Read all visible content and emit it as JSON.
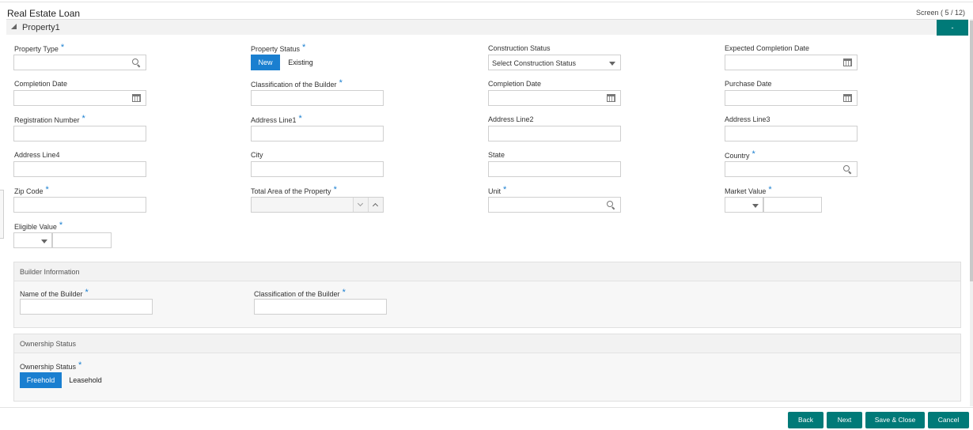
{
  "header": {
    "title": "Real Estate Loan",
    "screen_counter": "Screen ( 5 / 12)"
  },
  "section": {
    "title": "Property1",
    "collapse_label": "-"
  },
  "fields": {
    "property_type": {
      "label": "Property Type",
      "required": "*"
    },
    "property_status": {
      "label": "Property Status",
      "required": "*",
      "options": [
        "New",
        "Existing"
      ],
      "selected": "New"
    },
    "construction_status": {
      "label": "Construction Status",
      "value": "Select Construction Status"
    },
    "expected_completion_date": {
      "label": "Expected Completion Date"
    },
    "completion_date_1": {
      "label": "Completion Date"
    },
    "classification_builder": {
      "label": "Classification of the Builder",
      "required": "*"
    },
    "completion_date_2": {
      "label": "Completion Date"
    },
    "purchase_date": {
      "label": "Purchase Date"
    },
    "registration_number": {
      "label": "Registration Number",
      "required": "*"
    },
    "address_line1": {
      "label": "Address Line1",
      "required": "*"
    },
    "address_line2": {
      "label": "Address Line2"
    },
    "address_line3": {
      "label": "Address Line3"
    },
    "address_line4": {
      "label": "Address Line4"
    },
    "city": {
      "label": "City"
    },
    "state": {
      "label": "State"
    },
    "country": {
      "label": "Country",
      "required": "*"
    },
    "zip_code": {
      "label": "Zip Code",
      "required": "*"
    },
    "total_area": {
      "label": "Total Area of the Property",
      "required": "*"
    },
    "unit": {
      "label": "Unit",
      "required": "*"
    },
    "market_value": {
      "label": "Market Value",
      "required": "*"
    },
    "eligible_value": {
      "label": "Eligible Value",
      "required": "*"
    }
  },
  "builder_info": {
    "title": "Builder Information",
    "name_label": "Name of the Builder",
    "name_required": "*",
    "class_label": "Classification of the Builder",
    "class_required": "*"
  },
  "ownership": {
    "title": "Ownership Status",
    "label": "Ownership Status",
    "required": "*",
    "options": [
      "Freehold",
      "Leasehold"
    ],
    "selected": "Freehold"
  },
  "footer": {
    "back": "Back",
    "next": "Next",
    "save_close": "Save & Close",
    "cancel": "Cancel"
  },
  "colors": {
    "accent": "#007a78",
    "toggle_active": "#1a7fd0",
    "required_marker": "#1a7fd0"
  }
}
